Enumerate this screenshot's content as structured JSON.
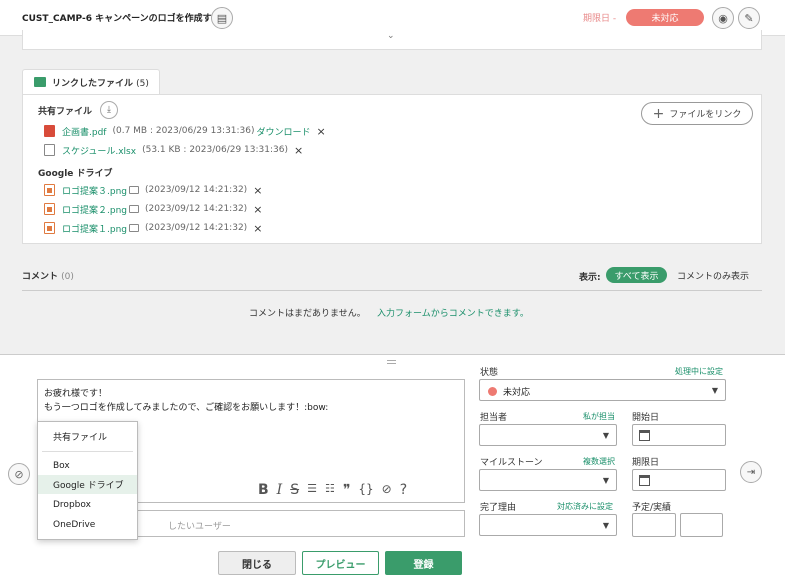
{
  "header": {
    "title": "CUST_CAMP-6 キャンペーンのロゴを作成する",
    "due_label": "期限日 -",
    "status": "未対応",
    "icons": [
      "clipboard-icon",
      "eye-icon",
      "pencil-icon"
    ]
  },
  "files_tab": {
    "label": "リンクしたファイル",
    "count": "(5)"
  },
  "shared_files": {
    "label": "共有ファイル",
    "link_button": "ファイルをリンク",
    "items": [
      {
        "name": "企画書.pdf",
        "meta": "(0.7 MB : 2023/06/29 13:31:36)",
        "download": "ダウンロード"
      },
      {
        "name": "スケジュール.xlsx",
        "meta": "(53.1 KB : 2023/06/29 13:31:36)"
      }
    ]
  },
  "google_drive": {
    "label": "Google ドライブ",
    "items": [
      {
        "name": "ロゴ提案３.png",
        "meta": "(2023/09/12 14:21:32)"
      },
      {
        "name": "ロゴ提案２.png",
        "meta": "(2023/09/12 14:21:32)"
      },
      {
        "name": "ロゴ提案１.png",
        "meta": "(2023/09/12 14:21:32)"
      }
    ]
  },
  "comments": {
    "title": "コメント",
    "count": "(0)",
    "display_label": "表示:",
    "show_all": "すべて表示",
    "show_comments_only": "コメントのみ表示",
    "empty": "コメントはまだありません。",
    "empty_link": "入力フォームからコメントできます。"
  },
  "editor": {
    "line1": "お疲れ様です！",
    "line2": "もう一つロゴを作成してみましたので、ご確認をお願いします！:bow:",
    "toolbar": [
      "B",
      "I",
      "S",
      "☰",
      "☷",
      "❞",
      "{}",
      "⊘",
      "?"
    ],
    "notify_placeholder": "したいユーザー"
  },
  "attach_menu": {
    "items": [
      "共有ファイル",
      "Box",
      "Google ドライブ",
      "Dropbox",
      "OneDrive"
    ],
    "active_index": 2
  },
  "form": {
    "status_label": "状態",
    "status_link": "処理中に設定",
    "status_value": "未対応",
    "assignee_label": "担当者",
    "assignee_link": "私が担当",
    "start_label": "開始日",
    "milestone_label": "マイルストーン",
    "milestone_link": "複数選択",
    "due_label": "期限日",
    "reason_label": "完了理由",
    "reason_link": "対応済みに設定",
    "estimate_label": "予定/実績"
  },
  "actions": {
    "close": "閉じる",
    "preview": "プレビュー",
    "submit": "登録"
  },
  "colors": {
    "accent": "#3a9c6b",
    "status": "#ee7a72",
    "link": "#1a8f6a"
  }
}
